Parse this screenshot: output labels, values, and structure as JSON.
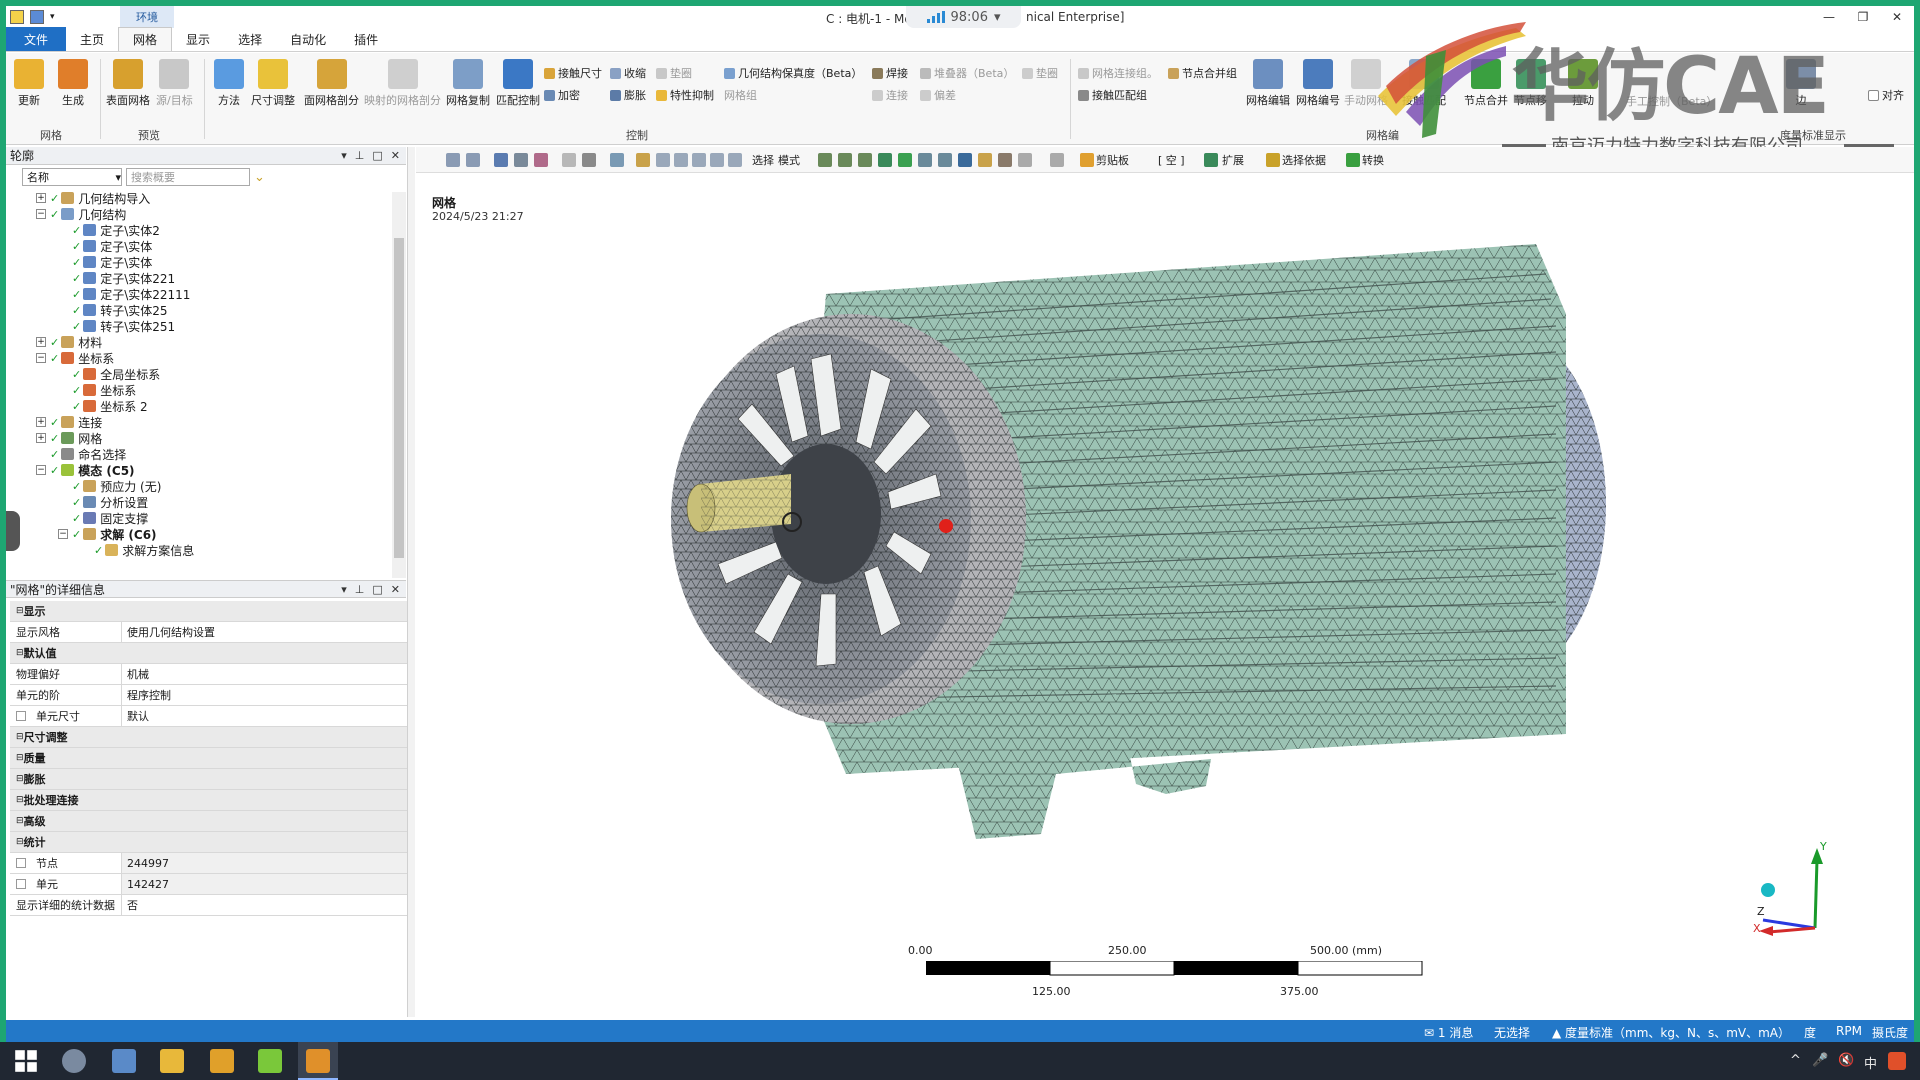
{
  "window": {
    "title_left": "C : 电机-1 - Me",
    "title_right": "nical Enterprise]",
    "meter_value": "98:06",
    "controls": [
      "—",
      "❐",
      "✕"
    ]
  },
  "ribbon": {
    "context_label": "环境",
    "tabs": [
      "文件",
      "主页",
      "网格",
      "显示",
      "选择",
      "自动化",
      "插件"
    ],
    "active_tab": "网格",
    "groups": {
      "mesh": "网格",
      "preview": "预览",
      "control": "控制",
      "mesh_edit": "网格编",
      "metric_display": "度量标准显示"
    },
    "big_buttons": [
      {
        "label": "更新",
        "color": "#e9b233"
      },
      {
        "label": "生成",
        "color": "#e07e2a"
      },
      {
        "label": "表面网格",
        "color": "#d7a02e"
      },
      {
        "label": "源/目标",
        "color": "#b0b0b0"
      },
      {
        "label": "方法",
        "color": "#5a9be0"
      },
      {
        "label": "尺寸调整",
        "color": "#e9c23a"
      },
      {
        "label": "面网格剖分",
        "color": "#d6a43a"
      },
      {
        "label": "映射的网格剖分",
        "color": "#bdbdbd"
      },
      {
        "label": "网格复制",
        "color": "#7d9ec7"
      },
      {
        "label": "匹配控制",
        "color": "#3b78c5"
      },
      {
        "label": "网格编辑",
        "color": "#6c8fc0"
      },
      {
        "label": "网格编号",
        "color": "#4c7cbd"
      },
      {
        "label": "手动网格",
        "color": "#bdbdbd"
      },
      {
        "label": "接触匹配",
        "color": "#8aa7c9"
      },
      {
        "label": "节点合并",
        "color": "#3aa040"
      },
      {
        "label": "节点移",
        "color": "#4a9b6a"
      },
      {
        "label": "拉动",
        "color": "#6c9c3c"
      },
      {
        "label": "边",
        "color": "#7c8ea8"
      }
    ],
    "small_buttons": {
      "contact_size": "接触尺寸",
      "refine": "加密",
      "shrink": "收缩",
      "inflate": "膨胀",
      "gasket": "垫圈",
      "feature_suppress": "特性抑制",
      "geom_fidelity": "几何结构保真度（Beta）",
      "mesh_group": "网格组",
      "weld": "焊接",
      "stacker": "堆叠器（Beta）",
      "connect": "连接",
      "offset": "偏差",
      "washer": "垫圈",
      "mesh_connect_group": "网格连接组。",
      "contact_match_group": "接触匹配组",
      "node_merge_group": "节点合并组",
      "free_beta": "手工控制（Beta）",
      "align": "对齐"
    }
  },
  "watermark": {
    "brand": "华仿CAE",
    "company": "南京迈力特力数字科技有限公司"
  },
  "outline": {
    "title": "轮廓",
    "controls": [
      "▾",
      "⊥",
      "□",
      "✕"
    ],
    "filter_select": "名称",
    "search_placeholder": "搜索概要",
    "tree": [
      {
        "label": "几何结构导入",
        "level": 1,
        "exp": "+",
        "icon": "#c9a25a",
        "bold": false
      },
      {
        "label": "几何结构",
        "level": 1,
        "exp": "−",
        "icon": "#7a9cc8",
        "bold": false
      },
      {
        "label": "定子\\实体2",
        "level": 2,
        "exp": "",
        "icon": "#5f86c4",
        "bold": false
      },
      {
        "label": "定子\\实体",
        "level": 2,
        "exp": "",
        "icon": "#5f86c4",
        "bold": false
      },
      {
        "label": "定子\\实体",
        "level": 2,
        "exp": "",
        "icon": "#5f86c4",
        "bold": false
      },
      {
        "label": "定子\\实体221",
        "level": 2,
        "exp": "",
        "icon": "#5f86c4",
        "bold": false
      },
      {
        "label": "定子\\实体22111",
        "level": 2,
        "exp": "",
        "icon": "#5f86c4",
        "bold": false
      },
      {
        "label": "转子\\实体25",
        "level": 2,
        "exp": "",
        "icon": "#5f86c4",
        "bold": false
      },
      {
        "label": "转子\\实体251",
        "level": 2,
        "exp": "",
        "icon": "#5f86c4",
        "bold": false
      },
      {
        "label": "材料",
        "level": 1,
        "exp": "+",
        "icon": "#c9a25a",
        "bold": false
      },
      {
        "label": "坐标系",
        "level": 1,
        "exp": "−",
        "icon": "#d86a3a",
        "bold": false
      },
      {
        "label": "全局坐标系",
        "level": 2,
        "exp": "",
        "icon": "#d86a3a",
        "bold": false
      },
      {
        "label": "坐标系",
        "level": 2,
        "exp": "",
        "icon": "#d86a3a",
        "bold": false
      },
      {
        "label": "坐标系 2",
        "level": 2,
        "exp": "",
        "icon": "#d86a3a",
        "bold": false
      },
      {
        "label": "连接",
        "level": 1,
        "exp": "+",
        "icon": "#c9a25a",
        "bold": false
      },
      {
        "label": "网格",
        "level": 1,
        "exp": "+",
        "icon": "#6b9a5a",
        "bold": false
      },
      {
        "label": "命名选择",
        "level": 1,
        "exp": "",
        "icon": "#8a8a8a",
        "bold": false
      },
      {
        "label": "模态 (C5)",
        "level": 1,
        "exp": "−",
        "icon": "#9ac23a",
        "bold": true
      },
      {
        "label": "预应力 (无)",
        "level": 2,
        "exp": "",
        "icon": "#c9a25a",
        "bold": false
      },
      {
        "label": "分析设置",
        "level": 2,
        "exp": "",
        "icon": "#6a8ab4",
        "bold": false
      },
      {
        "label": "固定支撑",
        "level": 2,
        "exp": "",
        "icon": "#6a7ab4",
        "bold": false
      },
      {
        "label": "求解 (C6)",
        "level": 2,
        "exp": "−",
        "icon": "#c9a25a",
        "bold": true
      },
      {
        "label": "求解方案信息",
        "level": 3,
        "exp": "",
        "icon": "#d9b35a",
        "bold": false
      }
    ]
  },
  "details": {
    "title": "\"网格\"的详细信息",
    "controls": [
      "▾",
      "⊥",
      "□",
      "✕"
    ],
    "rows": [
      {
        "type": "sec",
        "key": "显示"
      },
      {
        "type": "kv",
        "key": "显示风格",
        "value": "使用几何结构设置"
      },
      {
        "type": "sec",
        "key": "默认值"
      },
      {
        "type": "kv",
        "key": "物理偏好",
        "value": "机械"
      },
      {
        "type": "kv",
        "key": "单元的阶",
        "value": "程序控制"
      },
      {
        "type": "kvcb",
        "key": "单元尺寸",
        "value": "默认"
      },
      {
        "type": "sec",
        "key": "尺寸调整"
      },
      {
        "type": "sec",
        "key": "质量"
      },
      {
        "type": "sec",
        "key": "膨胀"
      },
      {
        "type": "sec",
        "key": "批处理连接"
      },
      {
        "type": "sec",
        "key": "高级"
      },
      {
        "type": "sec",
        "key": "统计"
      },
      {
        "type": "kvcbs",
        "key": "节点",
        "value": "244997"
      },
      {
        "type": "kvcbs",
        "key": "单元",
        "value": "142427"
      },
      {
        "type": "kv",
        "key": "显示详细的统计数据",
        "value": "否"
      }
    ]
  },
  "viewport": {
    "toolbar": {
      "select": "选择",
      "mode": "模式",
      "clipboard": "剪贴板",
      "empty": "[ 空 ]",
      "extend": "扩展",
      "select_by": "选择依据",
      "convert": "转换"
    },
    "title": "网格",
    "date": "2024/5/23 21:27",
    "mesh_color": "#9cc3b4",
    "scale": {
      "top": [
        "0.00",
        "250.00",
        "500.00 (mm)"
      ],
      "bottom": [
        "125.00",
        "375.00"
      ]
    },
    "triad": {
      "y": "Y",
      "z": "Z",
      "x": "X"
    }
  },
  "status": {
    "messages": "1 消息",
    "selection": "无选择",
    "units": "度量标准（mm、kg、N、s、mV、mA）",
    "angle": "度",
    "rpm": "RPM",
    "temp": "摄氏度"
  },
  "taskbar": {
    "icons": [
      "start-icon",
      "app-icon",
      "calculator-icon",
      "folder-icon",
      "workbench-icon",
      "spaceclaim-icon",
      "mechanical-icon"
    ],
    "tray": [
      "^",
      "🎤",
      "🔇",
      "中"
    ]
  }
}
